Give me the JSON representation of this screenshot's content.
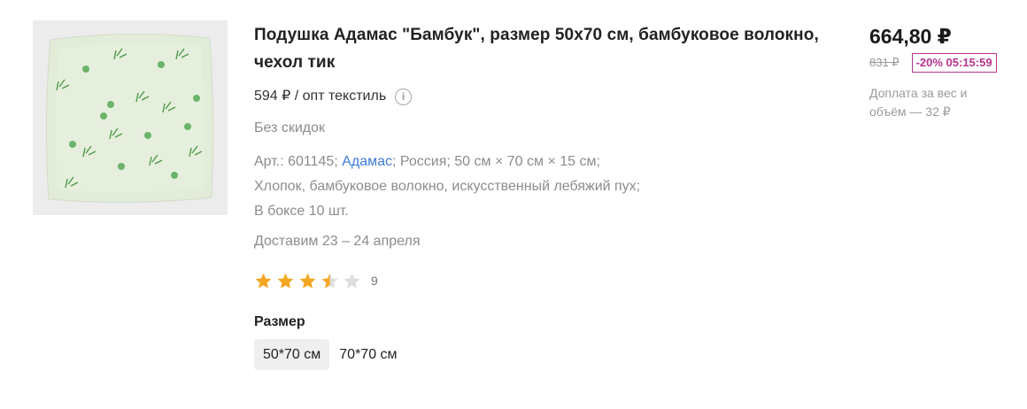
{
  "product": {
    "title": "Подушка Адамас \"Бамбук\", размер 50x70 см, бамбуковое волокно, чехол тик",
    "wholesale_price": "594 ₽ / опт текстиль",
    "info_icon_glyph": "i",
    "no_discount": "Без скидок",
    "specs": {
      "article": "Арт.: 601145;",
      "brand": "Адамас",
      "rest_line1": "; Россия; 50 см × 70 см × 15 см;",
      "line2": "Хлопок, бамбуковое волокно, искусственный лебяжий пух;",
      "line3": "В боксе 10 шт."
    },
    "delivery": "Доставим 23 – 24 апреля",
    "rating": {
      "value": 3.5,
      "max": 5,
      "reviews_count": "9"
    },
    "size": {
      "label": "Размер",
      "options": [
        "50*70 см",
        "70*70 см"
      ],
      "selected": "50*70 см"
    }
  },
  "pricing": {
    "price": "664,80 ₽",
    "old_price": "831 ₽",
    "discount_badge": "-20% 05:15:59",
    "surcharge": "Доплата за вес и объём — 32 ₽"
  },
  "colors": {
    "accent_link": "#3f7ad6",
    "discount": "#b8338c",
    "star_filled": "#f5a623",
    "star_empty": "#dedede"
  },
  "icons": {
    "info": "info-circle-icon",
    "star": "star-icon"
  }
}
